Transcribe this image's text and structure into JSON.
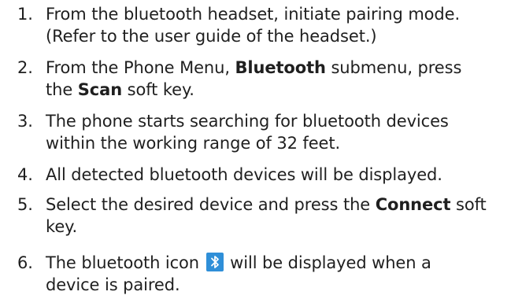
{
  "steps": [
    {
      "number": "1.",
      "lines": [
        "From the bluetooth headset, initiate pairing mode.",
        "(Refer to the user guide of the headset.)"
      ]
    },
    {
      "number": "2.",
      "line1_a": "From the Phone Menu, ",
      "line1_bold": "Bluetooth",
      "line1_b": " submenu, press",
      "line2_a": "the ",
      "line2_bold": "Scan",
      "line2_b": " soft key."
    },
    {
      "number": "3.",
      "lines": [
        "The phone starts searching for bluetooth devices",
        "within the working range of 32 feet."
      ]
    },
    {
      "number": "4.",
      "lines": [
        "All detected bluetooth devices will be displayed."
      ]
    },
    {
      "number": "5.",
      "line1_a": "Select the desired device and press the ",
      "line1_bold": "Connect",
      "line1_b": " soft",
      "line2": "key."
    },
    {
      "number": "6.",
      "line1_a": "The bluetooth icon ",
      "line1_b": " will be displayed when a",
      "line2": "device is paired."
    }
  ],
  "colors": {
    "text": "#1f1f1f",
    "bluetooth_badge": "#2f8fd8"
  },
  "icons": {
    "bluetooth": "bluetooth-icon"
  }
}
